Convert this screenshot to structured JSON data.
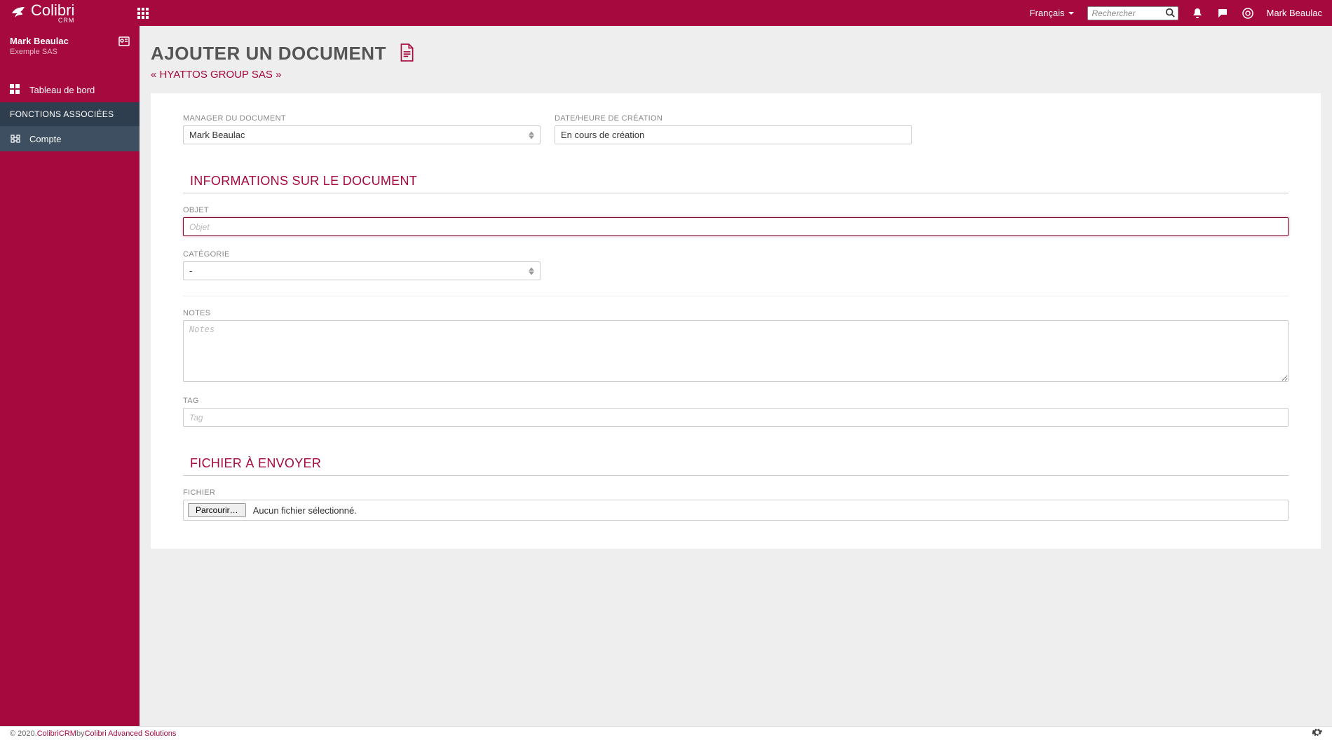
{
  "brand": {
    "name": "Colibri",
    "sub": "CRM"
  },
  "topbar": {
    "language": "Français",
    "search_placeholder": "Rechercher",
    "user": "Mark Beaulac"
  },
  "sidebar": {
    "user_name": "Mark Beaulac",
    "user_sub": "Exemple SAS",
    "dashboard": "Tableau de bord",
    "section_title": "FONCTIONS ASSOCIÉES",
    "account": "Compte"
  },
  "page": {
    "title": "AJOUTER UN DOCUMENT",
    "breadcrumb": "« HYATTOS GROUP SAS »"
  },
  "form": {
    "manager_label": "MANAGER DU DOCUMENT",
    "manager_value": "Mark Beaulac",
    "created_label": "DATE/HEURE DE CRÉATION",
    "created_value": "En cours de création",
    "section_info": "INFORMATIONS SUR LE DOCUMENT",
    "objet_label": "OBJET",
    "objet_placeholder": "Objet",
    "categorie_label": "CATÉGORIE",
    "categorie_value": "-",
    "notes_label": "NOTES",
    "notes_placeholder": "Notes",
    "tag_label": "TAG",
    "tag_placeholder": "Tag",
    "section_file": "FICHIER À ENVOYER",
    "file_label": "FICHIER",
    "browse_label": "Parcourir…",
    "file_status": "Aucun fichier sélectionné."
  },
  "footer": {
    "copyright": "© 2020. ",
    "link1": "ColibriCRM",
    "by": " by ",
    "link2": "Colibri Advanced Solutions"
  }
}
